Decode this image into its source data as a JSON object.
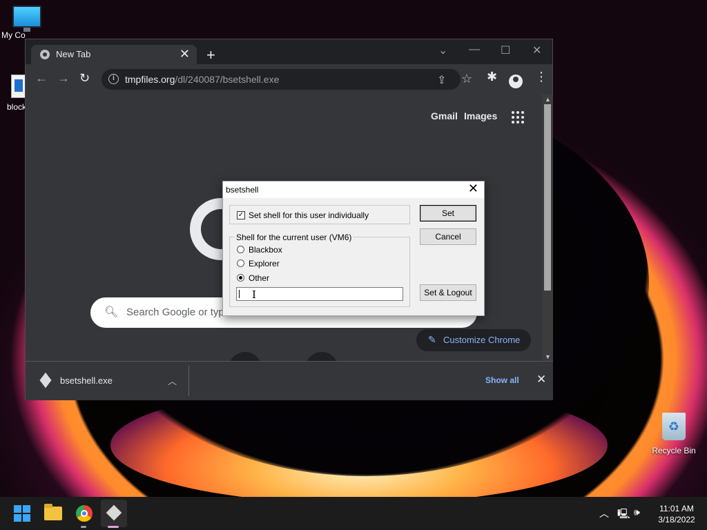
{
  "desktop": {
    "icons": [
      {
        "label": "My Co",
        "icon": "computer-icon"
      },
      {
        "label": "block",
        "icon": "document-icon"
      },
      {
        "label": "Recycle Bin",
        "icon": "recycle-bin-icon"
      }
    ]
  },
  "browser": {
    "tab": {
      "title": "New Tab",
      "close": "✕"
    },
    "new_tab": "+",
    "window_controls": {
      "dropdown": "⌄",
      "minimize": "—",
      "maximize": "☐",
      "close": "✕"
    },
    "toolbar": {
      "back": "←",
      "forward": "→",
      "reload": "↻"
    },
    "omnibox": {
      "host": "tmpfiles.org",
      "path": "/dl/240087/bsetshell.exe"
    },
    "page": {
      "gmail": "Gmail",
      "images": "Images",
      "search_placeholder": "Search Google or type a URL",
      "customize": "Customize Chrome"
    },
    "downloads": {
      "filename": "bsetshell.exe",
      "show_all": "Show all",
      "close": "✕"
    }
  },
  "dialog": {
    "title": "bsetshell",
    "close": "✕",
    "checkbox_label": "Set shell for this user individually",
    "checkbox_checked": true,
    "group_legend": "Shell for the current user (VM6)",
    "options": [
      "Blackbox",
      "Explorer",
      "Other"
    ],
    "selected": "Other",
    "other_value": "",
    "buttons": {
      "set": "Set",
      "cancel": "Cancel",
      "set_logout": "Set & Logout"
    }
  },
  "taskbar": {
    "time": "11:01 AM",
    "date": "3/18/2022"
  },
  "colors": {
    "accent_blue": "#8ab4f8",
    "chrome_dark": "#35363a",
    "start_blue": "#3aa6f5"
  }
}
